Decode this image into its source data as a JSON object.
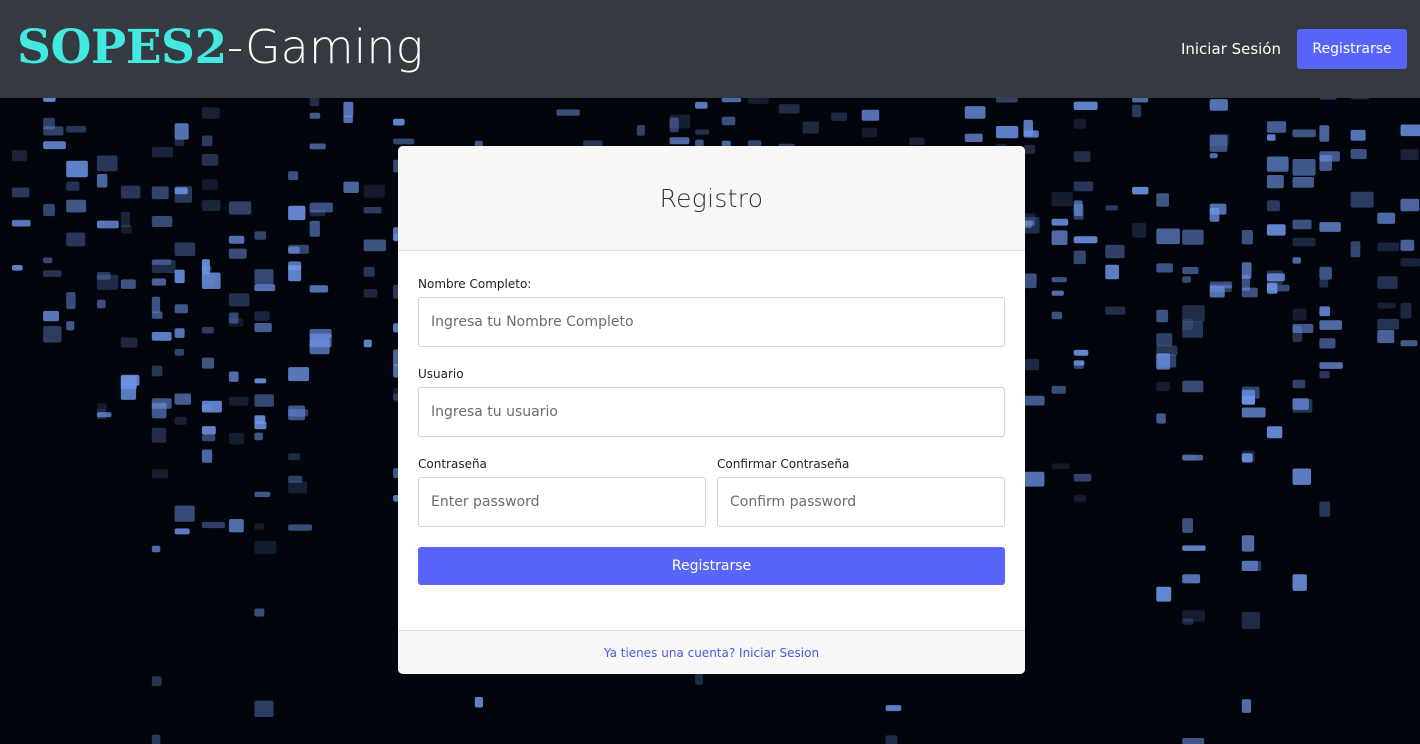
{
  "colors": {
    "navbar_bg": "#343a40",
    "brand_accent": "#43e8e0",
    "primary": "#5865f9",
    "link": "#4c5bd4",
    "matrix_glyph": "#6f96e8"
  },
  "navbar": {
    "brand_strong": "SOPES2",
    "brand_rest": "-Gaming",
    "login_link": "Iniciar Sesión",
    "register_button": "Registrarse"
  },
  "card": {
    "title": "Registro",
    "fields": {
      "full_name": {
        "label": "Nombre Completo:",
        "placeholder": "Ingresa tu Nombre Completo",
        "value": ""
      },
      "username": {
        "label": "Usuario",
        "placeholder": "Ingresa tu usuario",
        "value": ""
      },
      "password": {
        "label": "Contraseña",
        "placeholder": "Enter password",
        "value": ""
      },
      "confirm_password": {
        "label": "Confirmar Contraseña",
        "placeholder": "Confirm password",
        "value": ""
      }
    },
    "submit_label": "Registrarse",
    "footer_link": "Ya tienes una cuenta? Iniciar Sesion"
  }
}
